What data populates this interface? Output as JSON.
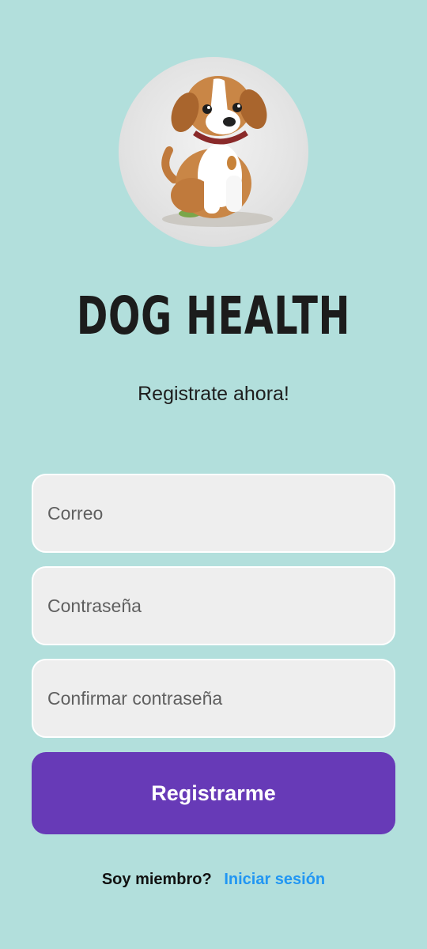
{
  "header": {
    "logo_icon": "dog-icon",
    "title": "DOG HEALTH",
    "subtitle": "Registrate ahora!"
  },
  "form": {
    "email_placeholder": "Correo",
    "email_value": "",
    "password_placeholder": "Contraseña",
    "password_value": "",
    "confirm_placeholder": "Confirmar contraseña",
    "confirm_value": "",
    "submit_label": "Registrarme"
  },
  "footer": {
    "question": "Soy miembro?",
    "login_link": "Iniciar sesión"
  },
  "colors": {
    "background": "#b2dfdc",
    "primary": "#673ab7",
    "link": "#2196f3",
    "field_bg": "#eeeeee"
  }
}
